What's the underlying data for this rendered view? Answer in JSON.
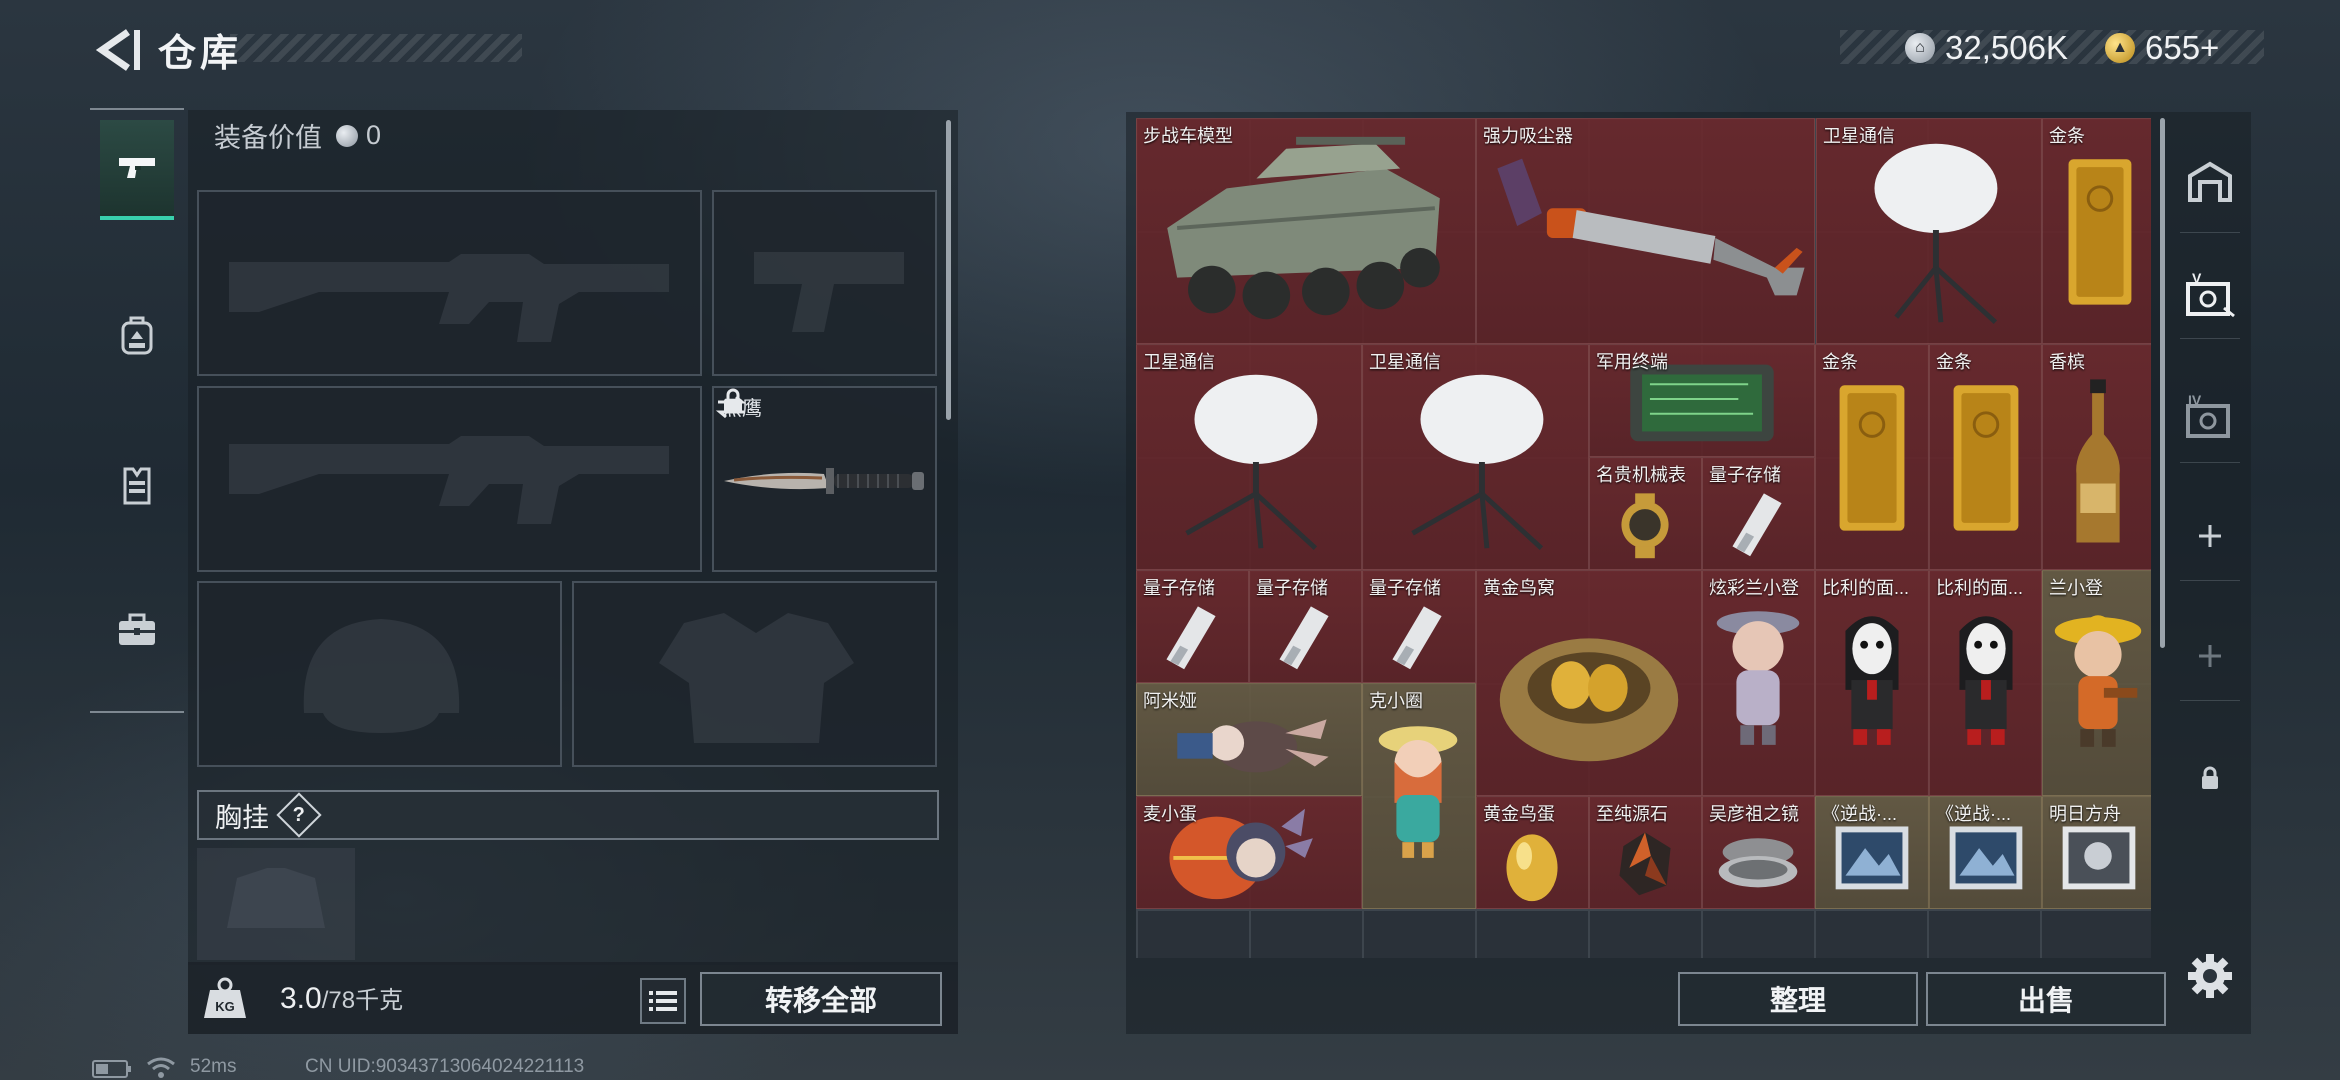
{
  "header": {
    "title": "仓库",
    "currencies": [
      {
        "icon": "silver-coin-icon",
        "value": "32,506K"
      },
      {
        "icon": "gold-coin-icon",
        "value": "655+"
      }
    ]
  },
  "tabs": [
    {
      "name": "weapon-tab",
      "icon": "pistol-icon",
      "active": true
    },
    {
      "name": "backpack-tab",
      "icon": "backpack-icon",
      "active": false
    },
    {
      "name": "chest-rig-tab",
      "icon": "vest-icon",
      "active": false
    },
    {
      "name": "case-tab",
      "icon": "briefcase-icon",
      "active": false
    }
  ],
  "equipment": {
    "value_label": "装备价值",
    "value": "0",
    "melee_slot_label": "黑鹰",
    "chest_rig_label": "胸挂",
    "help_glyph": "?"
  },
  "bottom": {
    "weight_current": "3.0",
    "weight_max": "/78千克",
    "kg_badge": "KG",
    "transfer_all": "转移全部",
    "organize": "整理",
    "sell": "出售"
  },
  "warehouse_items": [
    {
      "name": "步战车模型",
      "icon": "ifv-model-icon",
      "tier": "red"
    },
    {
      "name": "强力吸尘器",
      "icon": "vacuum-cleaner-icon",
      "tier": "red"
    },
    {
      "name": "卫星通信",
      "icon": "satellite-dish-icon",
      "tier": "red"
    },
    {
      "name": "金条",
      "icon": "gold-bar-icon",
      "tier": "red"
    },
    {
      "name": "卫星通信",
      "icon": "satellite-dish-icon",
      "tier": "red"
    },
    {
      "name": "卫星通信",
      "icon": "satellite-dish-icon",
      "tier": "red"
    },
    {
      "name": "军用终端",
      "icon": "military-terminal-icon",
      "tier": "red"
    },
    {
      "name": "金条",
      "icon": "gold-bar-icon",
      "tier": "red"
    },
    {
      "name": "金条",
      "icon": "gold-bar-icon",
      "tier": "red"
    },
    {
      "name": "香槟",
      "icon": "champagne-icon",
      "tier": "red"
    },
    {
      "name": "名贵机械表",
      "icon": "watch-icon",
      "tier": "red"
    },
    {
      "name": "量子存储",
      "icon": "quantum-drive-icon",
      "tier": "red"
    },
    {
      "name": "量子存储",
      "icon": "quantum-drive-icon",
      "tier": "red"
    },
    {
      "name": "量子存储",
      "icon": "quantum-drive-icon",
      "tier": "red"
    },
    {
      "name": "量子存储",
      "icon": "quantum-drive-icon",
      "tier": "red"
    },
    {
      "name": "黄金鸟窝",
      "icon": "golden-nest-icon",
      "tier": "red"
    },
    {
      "name": "炫彩兰小登",
      "icon": "figurine-icon",
      "tier": "red"
    },
    {
      "name": "比利的面...",
      "icon": "billy-puppet-icon",
      "tier": "red"
    },
    {
      "name": "比利的面...",
      "icon": "billy-puppet-icon",
      "tier": "red"
    },
    {
      "name": "兰小登",
      "icon": "figurine-icon",
      "tier": "gold"
    },
    {
      "name": "阿米娅",
      "icon": "plush-doll-icon",
      "tier": "gold"
    },
    {
      "name": "克小圈",
      "icon": "figurine-icon",
      "tier": "gold"
    },
    {
      "name": "麦小蛋",
      "icon": "plush-doll-icon",
      "tier": "red"
    },
    {
      "name": "黄金鸟蛋",
      "icon": "golden-egg-icon",
      "tier": "red"
    },
    {
      "name": "至纯源石",
      "icon": "originium-icon",
      "tier": "red"
    },
    {
      "name": "吴彦祖之镜",
      "icon": "compact-mirror-icon",
      "tier": "red"
    },
    {
      "name": "《逆战·...",
      "icon": "game-card-icon",
      "tier": "gold"
    },
    {
      "name": "《逆战·...",
      "icon": "game-card-icon",
      "tier": "gold"
    },
    {
      "name": "明日方舟",
      "icon": "game-card-icon",
      "tier": "gold"
    }
  ],
  "status_bar": {
    "ping": "52ms",
    "uid": "CN UID:9034371306402422111​3"
  },
  "colors": {
    "accent": "#39d0ad",
    "red_tier": "#6e282c",
    "gold_tier": "#685c44"
  }
}
